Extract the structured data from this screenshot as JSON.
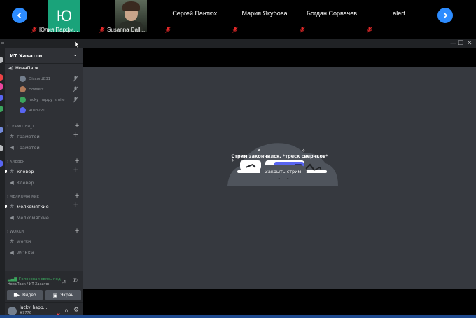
{
  "zoom": {
    "participants": [
      {
        "initial": "Ю",
        "name": "Юлия Парфи..."
      },
      {
        "name": "Susanna Dall..."
      },
      {
        "name": "Сергей  Пантюх..."
      },
      {
        "name": "Мария Якубова"
      },
      {
        "name": "Богдан Сорвачев"
      },
      {
        "name": "alert"
      }
    ],
    "tile_accent": "#1aa37a"
  },
  "discord": {
    "server_name": "ИТ Хакатон",
    "voice_channel": {
      "name": "НоваПарк",
      "users": [
        "Discord831",
        "Howlett",
        "lucky_happy_smile",
        "Rush220"
      ]
    },
    "categories": [
      {
        "name": "ГРАМОТЕИ_1",
        "channels": [
          "грамотеи",
          "Грамотеи"
        ]
      },
      {
        "name": "КЛЕВЕР",
        "channels": [
          "клевер",
          "Клевер"
        ]
      },
      {
        "name": "МЕЛКОМЯГКИЕ",
        "channels": [
          "мелкомягкие",
          "Мелкомягкие"
        ]
      },
      {
        "name": "WORKИ",
        "channels": [
          "workи",
          "WORKи"
        ]
      }
    ],
    "voice_panel": {
      "status": "Голосовая связь под",
      "location": "НоваПарк / ИТ Хакатон",
      "video_label": "Видео",
      "screen_label": "Экран"
    },
    "user": {
      "name": "lucky_happ...",
      "tag": "#9776"
    },
    "stage": {
      "message": "Стрим закончился. *треск сверчков*",
      "close_button": "Закрыть стрим"
    },
    "colors": {
      "blurple": "#5865f2",
      "green": "#3ba55d",
      "bg": "#36393f",
      "sidebar": "#2f3136"
    }
  }
}
